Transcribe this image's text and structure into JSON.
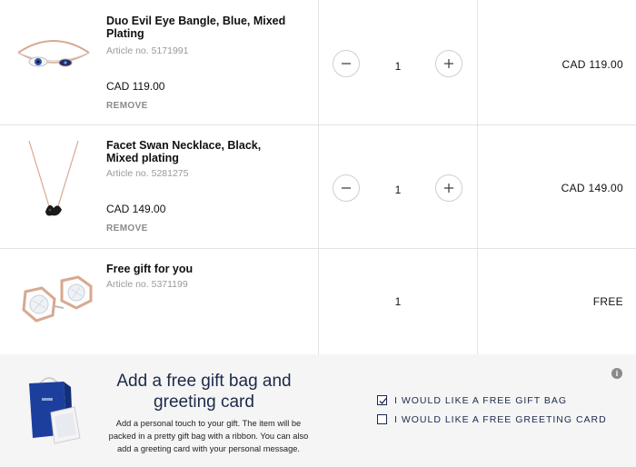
{
  "items": [
    {
      "name": "Duo Evil Eye Bangle, Blue, Mixed Plating",
      "article": "Article no. 5171991",
      "price": "CAD 119.00",
      "remove": "REMOVE",
      "qty": "1",
      "total": "CAD 119.00",
      "minus_label": "−",
      "plus_label": "+"
    },
    {
      "name": "Facet Swan Necklace, Black, Mixed plating",
      "article": "Article no. 5281275",
      "price": "CAD 149.00",
      "remove": "REMOVE",
      "qty": "1",
      "total": "CAD 149.00",
      "minus_label": "−",
      "plus_label": "+"
    },
    {
      "name": "Free gift for you",
      "article": "Article no. 5371199",
      "qty": "1",
      "total": "FREE"
    }
  ],
  "gift": {
    "title": "Add a free gift bag and greeting card",
    "description": "Add a personal touch to your gift. The item will be packed in a pretty gift bag with a ribbon. You can also add a greeting card with your personal message.",
    "options": [
      {
        "label": "I WOULD LIKE A FREE GIFT BAG",
        "checked": true
      },
      {
        "label": "I WOULD LIKE A FREE GREETING CARD",
        "checked": false
      }
    ],
    "info_icon": "i"
  },
  "colors": {
    "navy": "#1b2a4a",
    "border": "#e3e3e3",
    "panel": "#f5f5f5",
    "muted": "#9a9a9a"
  }
}
